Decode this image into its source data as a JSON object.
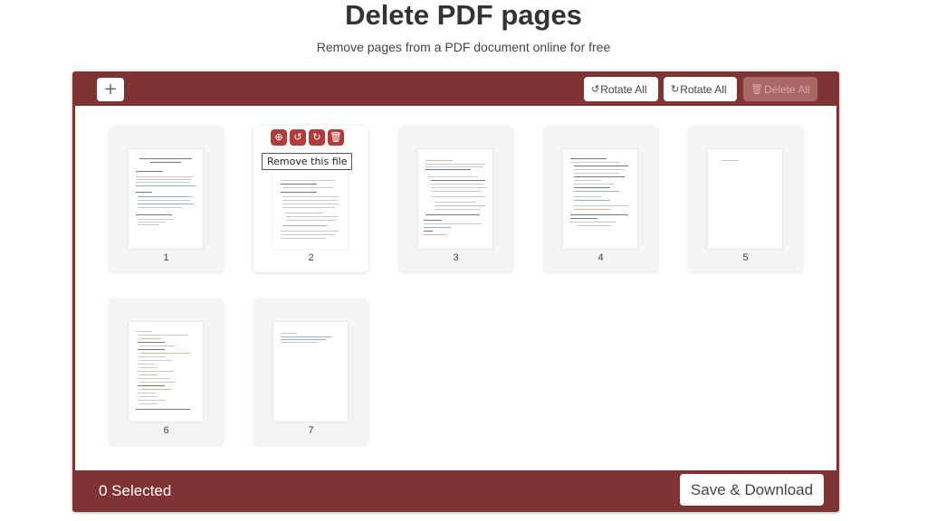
{
  "header": {
    "title": "Delete PDF pages",
    "subtitle": "Remove pages from a PDF document online for free"
  },
  "toolbar": {
    "add_label": "+",
    "rotate_left": {
      "icon": "↺",
      "label": "Rotate All"
    },
    "rotate_right": {
      "icon": "↻",
      "label": "Rotate All"
    },
    "delete_all": {
      "icon": "🗑",
      "label": "Delete All",
      "disabled": true
    }
  },
  "pages": [
    {
      "number": "1"
    },
    {
      "number": "2",
      "hovered": true
    },
    {
      "number": "3"
    },
    {
      "number": "4"
    },
    {
      "number": "5"
    },
    {
      "number": "6"
    },
    {
      "number": "7"
    }
  ],
  "page_actions": {
    "zoom_icon": "⊕",
    "rotate_left_icon": "↺",
    "rotate_right_icon": "↻",
    "delete_icon": "🗑",
    "tooltip": "Remove this file"
  },
  "footer": {
    "selected_text": "0 Selected",
    "save_label": "Save & Download"
  },
  "colors": {
    "brand": "#7f3333",
    "action": "#b53b3b"
  }
}
